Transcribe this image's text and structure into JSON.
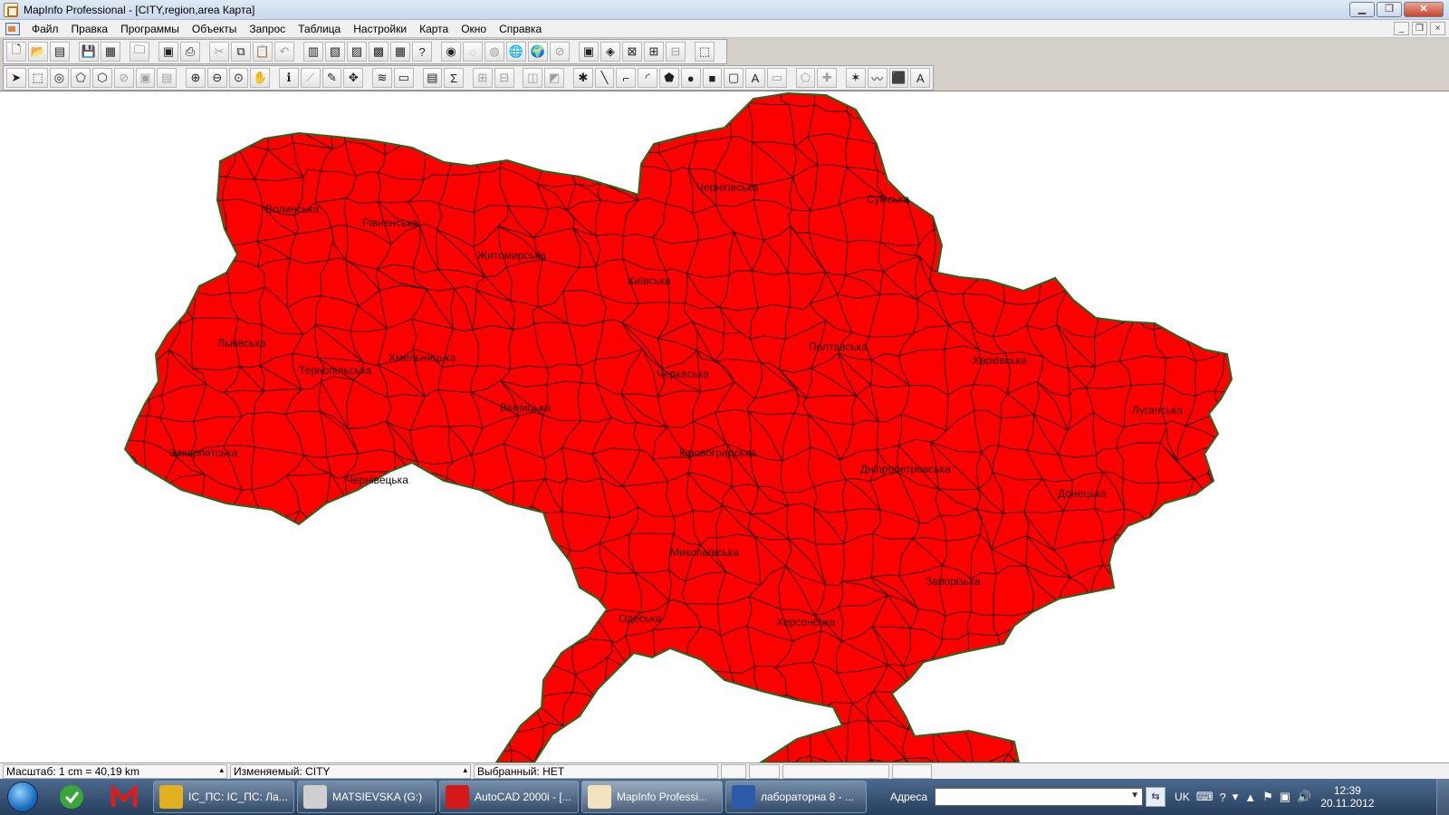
{
  "window": {
    "title": "MapInfo Professional - [CITY,region,area Карта]",
    "controls": {
      "minimize": "▁",
      "maximize": "❐",
      "close": "✕"
    },
    "doc_controls": {
      "minimize": "_",
      "restore": "❐",
      "close": "×"
    }
  },
  "menu": {
    "items": [
      "Файл",
      "Правка",
      "Программы",
      "Объекты",
      "Запрос",
      "Таблица",
      "Настройки",
      "Карта",
      "Окно",
      "Справка"
    ]
  },
  "toolbar_main": {
    "tools": [
      {
        "name": "new-icon",
        "glyph": "🗋"
      },
      {
        "name": "open-icon",
        "glyph": "📂"
      },
      {
        "name": "open-workspace-icon",
        "glyph": "▤"
      },
      {
        "sep": true
      },
      {
        "name": "save-icon",
        "glyph": "💾",
        "dim": true
      },
      {
        "name": "save-workspace-icon",
        "glyph": "▦"
      },
      {
        "sep": true
      },
      {
        "name": "open-dbms-icon",
        "glyph": "🗀"
      },
      {
        "sep": true
      },
      {
        "name": "print-preview-icon",
        "glyph": "▣"
      },
      {
        "name": "print-icon",
        "glyph": "⎙"
      },
      {
        "sep": true
      },
      {
        "name": "cut-icon",
        "glyph": "✂",
        "dim": true
      },
      {
        "name": "copy-icon",
        "glyph": "⧉"
      },
      {
        "name": "paste-icon",
        "glyph": "📋",
        "dim": true
      },
      {
        "name": "undo-icon",
        "glyph": "↶",
        "dim": true
      },
      {
        "sep": true
      },
      {
        "name": "new-browser-icon",
        "glyph": "▥"
      },
      {
        "name": "new-mapper-icon",
        "glyph": "▧"
      },
      {
        "name": "new-grapher-icon",
        "glyph": "▨"
      },
      {
        "name": "new-layout-icon",
        "glyph": "▩"
      },
      {
        "name": "redistrict-icon",
        "glyph": "▦"
      },
      {
        "name": "help-icon",
        "glyph": "?"
      },
      {
        "sep": true
      },
      {
        "name": "tool-1-icon",
        "glyph": "◉"
      },
      {
        "name": "tool-2-icon",
        "glyph": "◌",
        "dim": true
      },
      {
        "name": "tool-3-icon",
        "glyph": "◍",
        "dim": true
      },
      {
        "name": "globe-icon",
        "glyph": "🌐"
      },
      {
        "name": "globe-search-icon",
        "glyph": "🌍"
      },
      {
        "name": "tool-6-icon",
        "glyph": "⊘",
        "dim": true
      },
      {
        "sep": true
      },
      {
        "name": "tool-7-icon",
        "glyph": "▣"
      },
      {
        "name": "tool-8-icon",
        "glyph": "◈"
      },
      {
        "name": "tool-9-icon",
        "glyph": "⊠"
      },
      {
        "name": "tool-10-icon",
        "glyph": "⊞"
      },
      {
        "name": "tool-11-icon",
        "glyph": "⊟",
        "dim": true
      },
      {
        "sep": true
      },
      {
        "name": "tool-12-icon",
        "glyph": "⬚"
      }
    ]
  },
  "toolbar_draw": {
    "tools": [
      {
        "name": "select-icon",
        "glyph": "➤"
      },
      {
        "name": "marquee-select-icon",
        "glyph": "⬚"
      },
      {
        "name": "radius-select-icon",
        "glyph": "◎"
      },
      {
        "name": "polygon-select-icon",
        "glyph": "⬠"
      },
      {
        "name": "boundary-select-icon",
        "glyph": "⬡"
      },
      {
        "name": "unselect-all-icon",
        "glyph": "⊘",
        "dim": true
      },
      {
        "name": "invert-select-icon",
        "glyph": "▣",
        "dim": true
      },
      {
        "name": "graph-select-icon",
        "glyph": "▤",
        "dim": true
      },
      {
        "sep": true
      },
      {
        "name": "zoom-in-icon",
        "glyph": "⊕"
      },
      {
        "name": "zoom-out-icon",
        "glyph": "⊖"
      },
      {
        "name": "change-view-icon",
        "glyph": "⊙"
      },
      {
        "name": "grabber-icon",
        "glyph": "✋"
      },
      {
        "sep": true
      },
      {
        "name": "info-icon",
        "glyph": "ℹ"
      },
      {
        "name": "hotlink-icon",
        "glyph": "⟋",
        "dim": true
      },
      {
        "name": "label-icon",
        "glyph": "✎"
      },
      {
        "name": "drag-window-icon",
        "glyph": "✥"
      },
      {
        "sep": true
      },
      {
        "name": "layer-control-icon",
        "glyph": "≋"
      },
      {
        "name": "ruler-icon",
        "glyph": "▭"
      },
      {
        "sep": true
      },
      {
        "name": "legend-icon",
        "glyph": "▤"
      },
      {
        "name": "statistics-icon",
        "glyph": "Σ"
      },
      {
        "sep": true
      },
      {
        "name": "clip-region-icon",
        "glyph": "⊞",
        "dim": true
      },
      {
        "name": "setcliop-icon",
        "glyph": "⊟",
        "dim": true
      },
      {
        "sep": true
      },
      {
        "name": "tool-a-icon",
        "glyph": "◫",
        "dim": true
      },
      {
        "name": "tool-b-icon",
        "glyph": "◩",
        "dim": true
      },
      {
        "sep": true
      },
      {
        "name": "symbol-icon",
        "glyph": "✱"
      },
      {
        "name": "line-icon",
        "glyph": "╲"
      },
      {
        "name": "polyline-icon",
        "glyph": "⌐"
      },
      {
        "name": "arc-icon",
        "glyph": "◜"
      },
      {
        "name": "polygon-icon",
        "glyph": "⬟"
      },
      {
        "name": "ellipse-icon",
        "glyph": "●"
      },
      {
        "name": "rectangle-icon",
        "glyph": "■"
      },
      {
        "name": "rounded-rect-icon",
        "glyph": "▢"
      },
      {
        "name": "text-icon",
        "glyph": "A"
      },
      {
        "name": "frame-icon",
        "glyph": "▭",
        "dim": true
      },
      {
        "sep": true
      },
      {
        "name": "reshape-icon",
        "glyph": "⬠",
        "dim": true
      },
      {
        "name": "add-node-icon",
        "glyph": "✚",
        "dim": true
      },
      {
        "sep": true
      },
      {
        "name": "symbol-style-icon",
        "glyph": "✶"
      },
      {
        "name": "line-style-icon",
        "glyph": "〰"
      },
      {
        "name": "region-style-icon",
        "glyph": "⬛"
      },
      {
        "name": "text-style-icon",
        "glyph": "A"
      }
    ]
  },
  "map": {
    "fill_color": "#ff0000",
    "border_color": "#1a0000",
    "outline_color": "#1d6b1d",
    "labels": [
      {
        "text": "Волинська",
        "name": "label-volynska"
      },
      {
        "text": "Рівненська",
        "name": "label-rivnenska"
      },
      {
        "text": "Житомирська",
        "name": "label-zhytomyrska"
      },
      {
        "text": "Чернігівська",
        "name": "label-chernihivska"
      },
      {
        "text": "Сумська",
        "name": "label-sumska"
      },
      {
        "text": "Київська",
        "name": "label-kyivska"
      },
      {
        "text": "Львівська",
        "name": "label-lvivska"
      },
      {
        "text": "Хмельницька",
        "name": "label-khmelnytska"
      },
      {
        "text": "Тернопільська",
        "name": "label-ternopilska"
      },
      {
        "text": "Полтавська",
        "name": "label-poltavska"
      },
      {
        "text": "Харківська",
        "name": "label-kharkivska"
      },
      {
        "text": "Черкаська",
        "name": "label-cherkaska"
      },
      {
        "text": "Вінницька",
        "name": "label-vinnytska"
      },
      {
        "text": "Луганська",
        "name": "label-luhanska"
      },
      {
        "text": "Закарпатська",
        "name": "label-zakarpatska"
      },
      {
        "text": "Чернівецька",
        "name": "label-chernivetska"
      },
      {
        "text": "Кіровоградська",
        "name": "label-kirovohradska"
      },
      {
        "text": "Дніпропетровська",
        "name": "label-dnipropetrovska"
      },
      {
        "text": "Донецька",
        "name": "label-donetska"
      },
      {
        "text": "Миколаївська",
        "name": "label-mykolaivska"
      },
      {
        "text": "Запорізька",
        "name": "label-zaporizka"
      },
      {
        "text": "Одеська",
        "name": "label-odeska"
      },
      {
        "text": "Херсонська",
        "name": "label-khersonska"
      }
    ]
  },
  "status": {
    "scale": "Масштаб: 1 cm = 40,19 km",
    "editable": "Изменяемый: CITY",
    "selected": "Выбранный: НЕТ"
  },
  "taskbar": {
    "tasks": [
      {
        "label": "ІС_ПС: ІС_ПС: Ла...",
        "icon_color": "#e0b020",
        "name": "task-chrome"
      },
      {
        "label": "MATSIEVSKA (G:)",
        "icon_color": "#cfcfcf",
        "name": "task-explorer"
      },
      {
        "label": "AutoCAD 2000i - [...",
        "icon_color": "#d21a1a",
        "name": "task-autocad"
      },
      {
        "label": "MapInfo Professi...",
        "icon_color": "#f2e2c0",
        "name": "task-mapinfo",
        "active": true
      },
      {
        "label": "лабораторна 8 - ...",
        "icon_color": "#2a5aa8",
        "name": "task-word"
      }
    ],
    "address_label": "Адреса",
    "address_value": "",
    "language": "UK",
    "clock_time": "12:39",
    "clock_date": "20.11.2012"
  }
}
